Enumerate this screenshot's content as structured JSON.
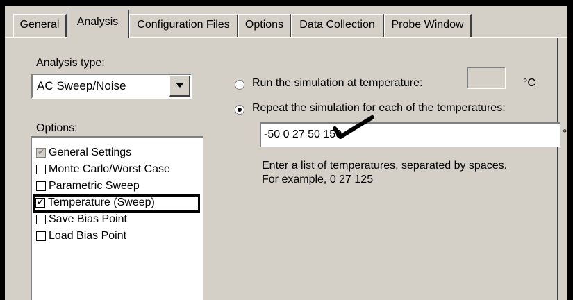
{
  "tabs": [
    {
      "label": "General",
      "active": false
    },
    {
      "label": "Analysis",
      "active": true
    },
    {
      "label": "Configuration Files",
      "active": false
    },
    {
      "label": "Options",
      "active": false
    },
    {
      "label": "Data Collection",
      "active": false
    },
    {
      "label": "Probe Window",
      "active": false
    }
  ],
  "analysis": {
    "type_label": "Analysis type:",
    "type_value": "AC Sweep/Noise",
    "options_label": "Options:",
    "options": [
      {
        "label": "General Settings",
        "checked": true,
        "disabled": true
      },
      {
        "label": "Monte Carlo/Worst Case",
        "checked": false,
        "disabled": false
      },
      {
        "label": "Parametric Sweep",
        "checked": false,
        "disabled": false
      },
      {
        "label": "Temperature (Sweep)",
        "checked": true,
        "disabled": false,
        "highlighted": true
      },
      {
        "label": "Save Bias Point",
        "checked": false,
        "disabled": false
      },
      {
        "label": "Load Bias Point",
        "checked": false,
        "disabled": false
      }
    ]
  },
  "temperature": {
    "run_at_label": "Run the simulation at temperature:",
    "run_at_value": "",
    "unit": "°C",
    "unit_cut": "°(",
    "repeat_label": "Repeat the simulation for each of the temperatures:",
    "repeat_selected": true,
    "temperatures_value": "-50 0 27 50 150",
    "help_line1": "Enter a list of temperatures, separated by spaces.",
    "help_line2": "For example, 0  27  125"
  },
  "icons": {
    "annotation": "checkmark-icon",
    "dropdown": "chevron-down-icon"
  },
  "colors": {
    "dialog_bg": "#d4d0c8",
    "frame": "#000000",
    "shadow": "#808080",
    "highlight": "#ffffff"
  }
}
